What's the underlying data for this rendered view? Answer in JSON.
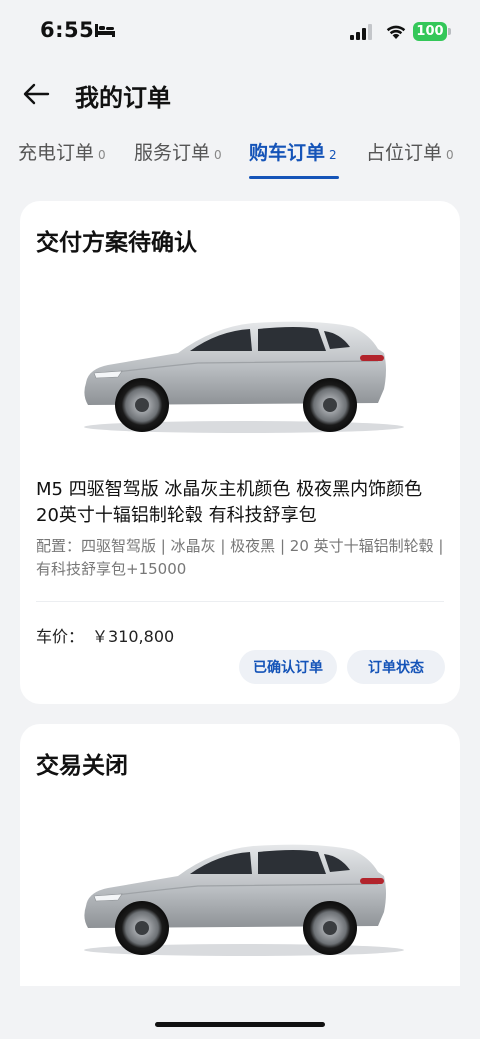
{
  "status_bar": {
    "time": "6:55",
    "battery": "100"
  },
  "header": {
    "title": "我的订单"
  },
  "tabs": [
    {
      "label": "充电订单",
      "count": "0"
    },
    {
      "label": "服务订单",
      "count": "0"
    },
    {
      "label": "购车订单",
      "count": "2"
    },
    {
      "label": "占位订单",
      "count": "0"
    }
  ],
  "active_tab": "购车订单",
  "orders": [
    {
      "status": "交付方案待确认",
      "title": "M5 四驱智驾版 冰晶灰主机颜色 极夜黑内饰颜色 20英寸十辐铝制轮毂 有科技舒享包",
      "config": "配置：四驱智驾版 | 冰晶灰 | 极夜黑 | 20 英寸十辐铝制轮毂 | 有科技舒享包+15000",
      "price_label": "车价：",
      "price": "￥310,800",
      "buttons": {
        "confirmed": "已确认订单",
        "status": "订单状态"
      }
    },
    {
      "status": "交易关闭"
    }
  ],
  "colors": {
    "accent": "#1554b8",
    "battery": "#34c759",
    "background": "#f2f3f5"
  },
  "icons": [
    "bed-icon",
    "signal-icon",
    "wifi-icon",
    "battery-icon",
    "back-arrow-icon"
  ]
}
